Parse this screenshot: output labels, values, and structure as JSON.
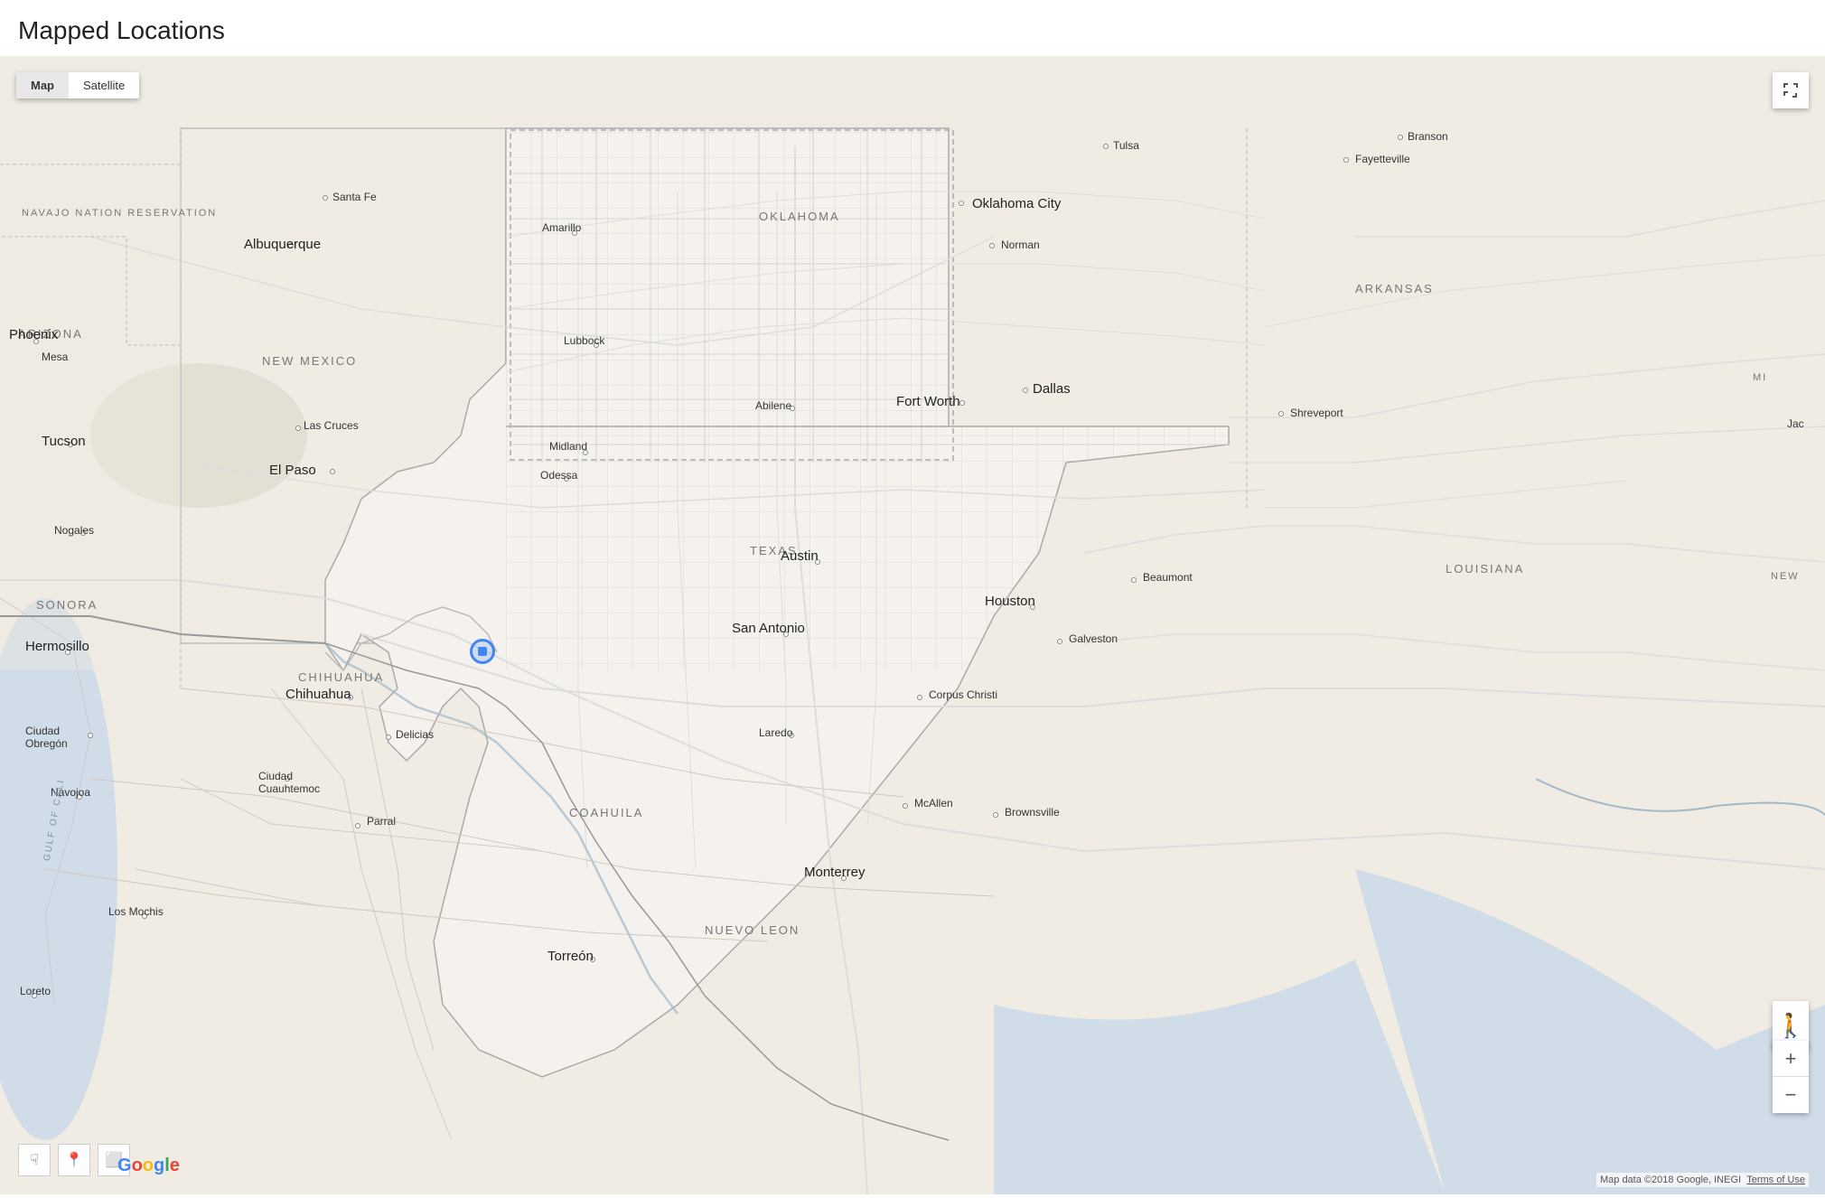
{
  "page": {
    "title": "Mapped Locations"
  },
  "map_controls": {
    "type_buttons": [
      {
        "id": "map",
        "label": "Map",
        "active": true
      },
      {
        "id": "satellite",
        "label": "Satellite",
        "active": false
      }
    ],
    "zoom_in": "+",
    "zoom_out": "−",
    "fullscreen_title": "Toggle fullscreen"
  },
  "attribution": {
    "text": "Map data ©2018 Google, INEGI",
    "terms": "Terms of Use"
  },
  "google_logo": "Google",
  "cities": [
    {
      "name": "Branson",
      "major": false
    },
    {
      "name": "Fayetteville",
      "major": false
    },
    {
      "name": "Tulsa",
      "major": false
    },
    {
      "name": "Oklahoma City",
      "major": true
    },
    {
      "name": "Norman",
      "major": false
    },
    {
      "name": "Shreveport",
      "major": false
    },
    {
      "name": "Santa Fe",
      "major": false
    },
    {
      "name": "Albuquerque",
      "major": true
    },
    {
      "name": "Amarillo",
      "major": false
    },
    {
      "name": "Lubbock",
      "major": false
    },
    {
      "name": "Fort Worth",
      "major": true
    },
    {
      "name": "Dallas",
      "major": true
    },
    {
      "name": "Abilene",
      "major": false
    },
    {
      "name": "Midland",
      "major": false
    },
    {
      "name": "Odessa",
      "major": false
    },
    {
      "name": "El Paso",
      "major": true
    },
    {
      "name": "Las Cruces",
      "major": false
    },
    {
      "name": "Tucson",
      "major": true
    },
    {
      "name": "Austin",
      "major": true
    },
    {
      "name": "Houston",
      "major": true
    },
    {
      "name": "San Antonio",
      "major": true
    },
    {
      "name": "Beaumont",
      "major": false
    },
    {
      "name": "Galveston",
      "major": false
    },
    {
      "name": "Corpus Christi",
      "major": false
    },
    {
      "name": "Laredo",
      "major": false
    },
    {
      "name": "McAllen",
      "major": false
    },
    {
      "name": "Brownsville",
      "major": false
    },
    {
      "name": "Monterrey",
      "major": false
    },
    {
      "name": "Hermosillo",
      "major": true
    },
    {
      "name": "Chihuahua",
      "major": true
    },
    {
      "name": "Ciudad Obregon",
      "major": false
    },
    {
      "name": "Nogales",
      "major": false
    },
    {
      "name": "Navojoa",
      "major": false
    },
    {
      "name": "Delicias",
      "major": false
    },
    {
      "name": "Ciudad Cuauhtemoc",
      "major": false
    },
    {
      "name": "Parral",
      "major": false
    },
    {
      "name": "Torreón",
      "major": false
    },
    {
      "name": "Los Mochis",
      "major": false
    },
    {
      "name": "Loreto",
      "major": false
    }
  ],
  "regions": [
    {
      "name": "TEXAS"
    },
    {
      "name": "NEW MEXICO"
    },
    {
      "name": "OKLAHOMA"
    },
    {
      "name": "ARKANSAS"
    },
    {
      "name": "LOUISIANA"
    },
    {
      "name": "ARIZONA"
    },
    {
      "name": "SONORA"
    },
    {
      "name": "CHIHUAHUA"
    },
    {
      "name": "COAHUILA"
    },
    {
      "name": "NUEVO LEON"
    },
    {
      "name": "NAVAJO NATION RESERVATION"
    }
  ],
  "marker": {
    "location": "Texas/Mexico border area"
  }
}
